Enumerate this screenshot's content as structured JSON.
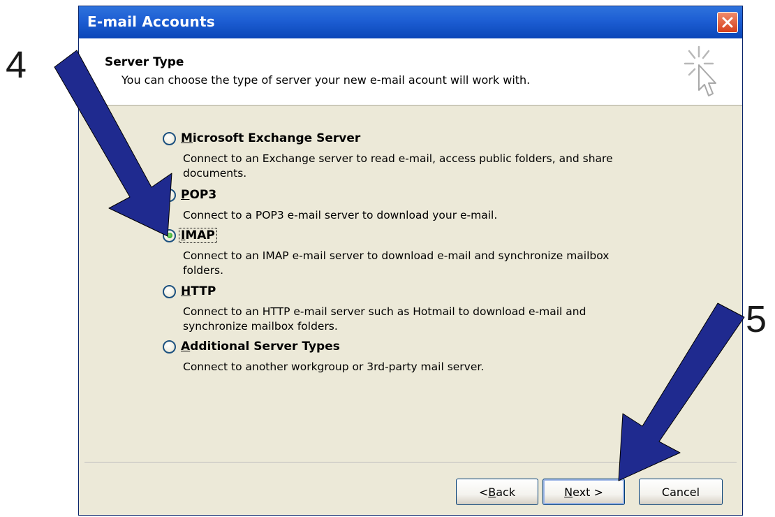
{
  "window": {
    "title": "E-mail Accounts"
  },
  "header": {
    "title": "Server Type",
    "subtitle": "You can choose the type of server your new e-mail acount will work with."
  },
  "options": [
    {
      "label": "Microsoft Exchange Server",
      "mnemonic": "M",
      "description": "Connect to an Exchange server to read e-mail, access public folders, and share documents.",
      "selected": false
    },
    {
      "label": "POP3",
      "mnemonic": "P",
      "description": "Connect to a POP3 e-mail server to download your e-mail.",
      "selected": false
    },
    {
      "label": "IMAP",
      "mnemonic": "I",
      "description": "Connect to an IMAP e-mail server to download e-mail and synchronize mailbox folders.",
      "selected": true
    },
    {
      "label": "HTTP",
      "mnemonic": "H",
      "description": "Connect to an HTTP e-mail server such as Hotmail to download e-mail and synchronize mailbox folders.",
      "selected": false
    },
    {
      "label": "Additional Server Types",
      "mnemonic": "A",
      "description": "Connect to another workgroup or 3rd-party mail server.",
      "selected": false
    }
  ],
  "buttons": {
    "back": "< Back",
    "next": "Next >",
    "cancel": "Cancel"
  },
  "annotations": {
    "step_a": "4",
    "step_b": "5",
    "arrow_color": "#1f2a8f"
  },
  "colors": {
    "titlebar": "#0a46b8",
    "dialog_bg": "#ece9d8",
    "close_button": "#d6401c"
  }
}
